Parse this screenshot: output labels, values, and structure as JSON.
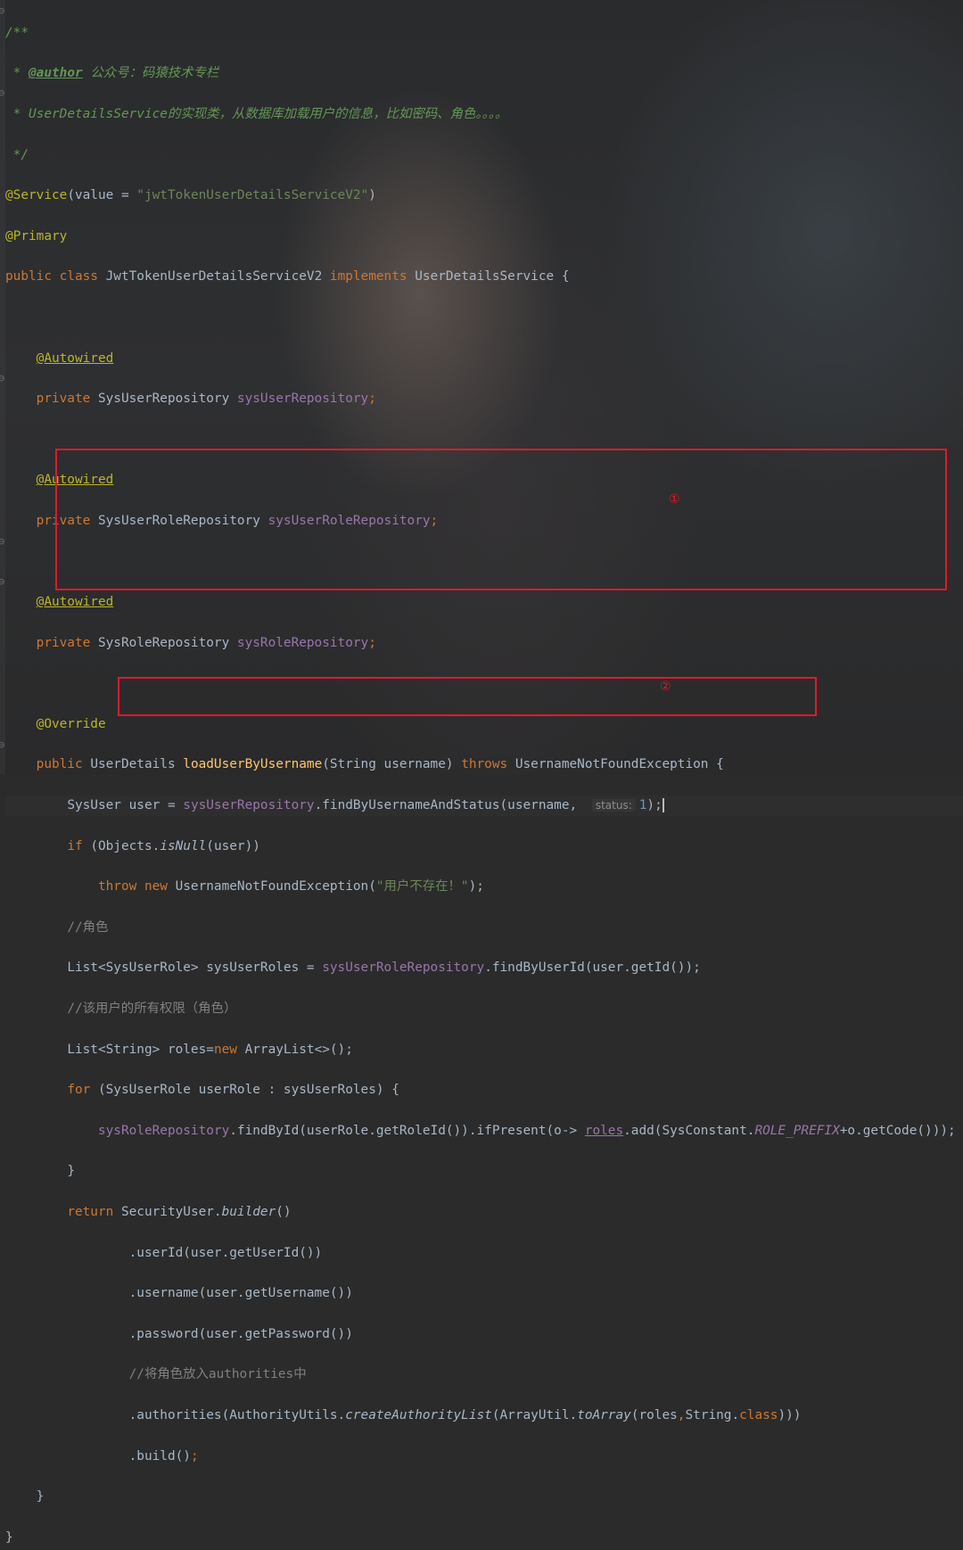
{
  "colors": {
    "background": "#2b2b2b",
    "plain": "#a9b7c6",
    "keyword": "#cc7832",
    "annotation": "#bbb529",
    "string": "#6a8759",
    "field": "#9876aa",
    "method": "#ffc66d",
    "comment": "#808080",
    "doc_comment": "#629755",
    "number": "#6897bb",
    "highlight_box": "#e0192a"
  },
  "gutter_icons": [
    "fold-open-icon",
    "fold-end-icon"
  ],
  "code": {
    "doc_open": "/**",
    "doc_star": " * ",
    "doc_tag": "@author",
    "doc_author": " 公众号：码猿技术专栏",
    "doc_desc": "UserDetailsService的实现类，从数据库加载用户的信息，比如密码、角色。。。。",
    "doc_close": " */",
    "service_ann": "@Service",
    "service_args_pre": "(value = ",
    "service_value": "\"jwtTokenUserDetailsServiceV2\"",
    "service_args_post": ")",
    "primary_ann": "@Primary",
    "kw_public_class": "public class ",
    "class_name": "JwtTokenUserDetailsServiceV2 ",
    "kw_implements": "implements ",
    "iface_name": "UserDetailsService {",
    "autowired": "@Autowired",
    "kw_private": "private ",
    "type_user_repo": "SysUserRepository ",
    "field_user_repo": "sysUserRepository",
    "type_user_role_repo": "SysUserRoleRepository ",
    "field_user_role_repo": "sysUserRoleRepository",
    "type_role_repo": "SysRoleRepository ",
    "field_role_repo": "sysRoleRepository",
    "semicolon": ";",
    "override": "@Override",
    "kw_public": "public ",
    "ret_type": "UserDetails ",
    "method_name": "loadUserByUsername",
    "params": "(String username) ",
    "kw_throws": "throws ",
    "exception_open": "UsernameNotFoundException {",
    "l_user_decl": "SysUser user = ",
    "l_find_call": ".findByUsernameAndStatus(username, ",
    "hint_status": "status:",
    "num_one": "1",
    "l_call_close": ");",
    "kw_if": "if ",
    "l_objects": "(Objects.",
    "is_null": "isNull",
    "l_user_arg": "(user))",
    "kw_throw": "throw ",
    "kw_new": "new ",
    "exception_ctor": "UsernameNotFoundException(",
    "msg_not_exist": "\"用户不存在！\"",
    "comment_role": "//角色",
    "l_list_roles": "List<SysUserRole> sysUserRoles = ",
    "l_find_by_user": ".findByUserId(user.getId());",
    "comment_all_perms": "//该用户的所有权限（角色）",
    "l_roles_decl": "List<String> roles=",
    "l_arraylist": "ArrayList<>();",
    "kw_for": "for ",
    "l_for_head": "(SysUserRole userRole : sysUserRoles) {",
    "l_find_by_id": ".findById(userRole.getRoleId()).ifPresent(o-> ",
    "roles_var": "roles",
    "l_add": ".add(SysConstant.",
    "role_prefix": "ROLE_PREFIX",
    "l_get_code": "+o.getCode()));",
    "close_brace": "}",
    "kw_return": "return ",
    "security_user": "SecurityUser.",
    "builder_fn": "builder",
    "empty_call": "()",
    "b_user_id": ".userId(user.getUserId())",
    "b_username": ".username(user.getUsername())",
    "b_password": ".password(user.getPassword())",
    "comment_authorities": "//将角色放入authorities中",
    "b_auth_pre": ".authorities(AuthorityUtils.",
    "create_authority_list": "createAuthorityList",
    "b_auth_mid": "(ArrayUtil.",
    "to_array": "toArray",
    "b_auth_args": "(roles",
    "comma": ",",
    "string_dot": "String.",
    "kw_class": "class",
    "b_auth_close": "))",
    "b_build": ".build()"
  },
  "markers": {
    "m1": "①",
    "m2": "②"
  }
}
